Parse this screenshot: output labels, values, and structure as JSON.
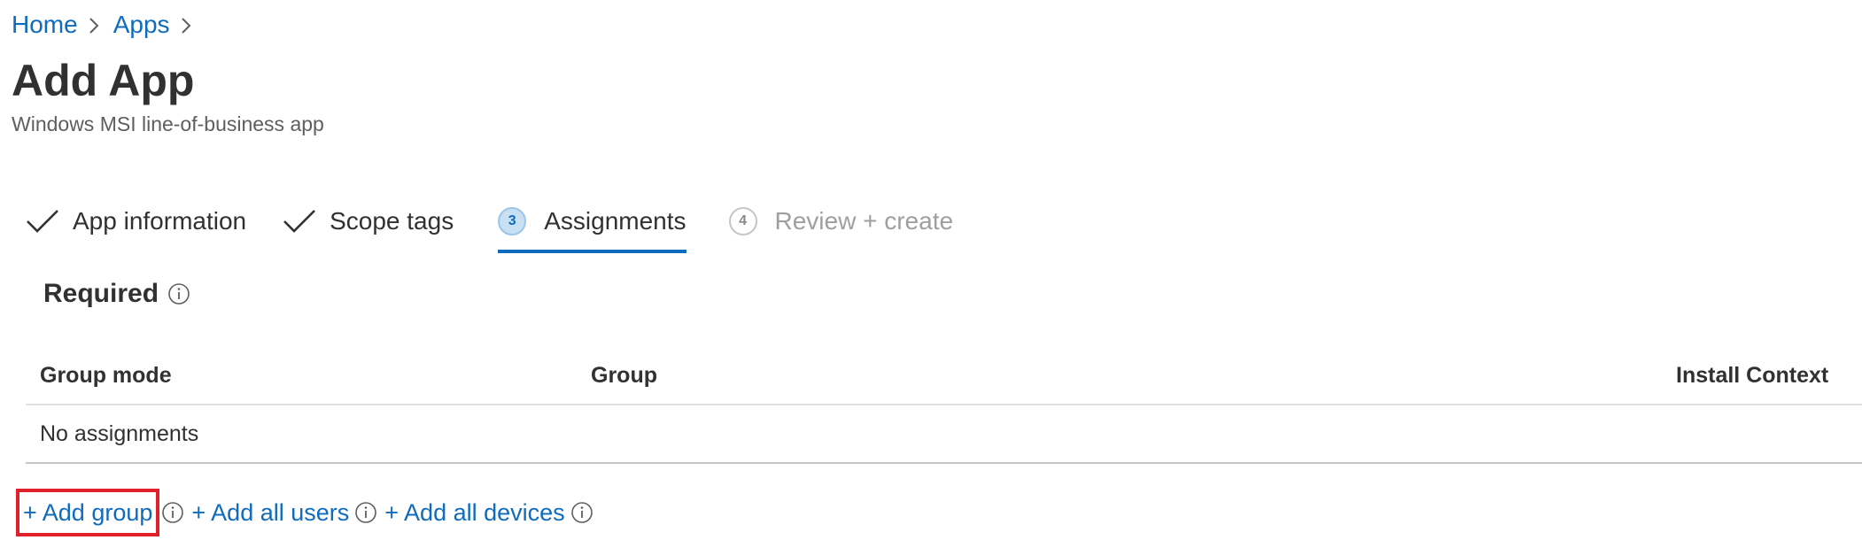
{
  "breadcrumb": {
    "items": [
      {
        "label": "Home"
      },
      {
        "label": "Apps"
      }
    ]
  },
  "page": {
    "title": "Add App",
    "subtitle": "Windows MSI line-of-business app"
  },
  "wizard": {
    "steps": [
      {
        "label": "App information",
        "state": "complete",
        "number": ""
      },
      {
        "label": "Scope tags",
        "state": "complete",
        "number": ""
      },
      {
        "label": "Assignments",
        "state": "current",
        "number": "3"
      },
      {
        "label": "Review + create",
        "state": "upcoming",
        "number": "4"
      }
    ]
  },
  "required": {
    "title": "Required",
    "icon": "info-icon"
  },
  "table": {
    "columns": [
      "Group mode",
      "Group",
      "Install Context"
    ],
    "empty_text": "No assignments"
  },
  "actions": {
    "add_group": "+ Add group",
    "add_all_users": "+ Add all users",
    "add_all_devices": "+ Add all devices"
  },
  "colors": {
    "accent": "#0f6cbd",
    "highlight_box": "#e0202a",
    "text_primary": "#323130",
    "text_disabled": "#a19f9d"
  }
}
